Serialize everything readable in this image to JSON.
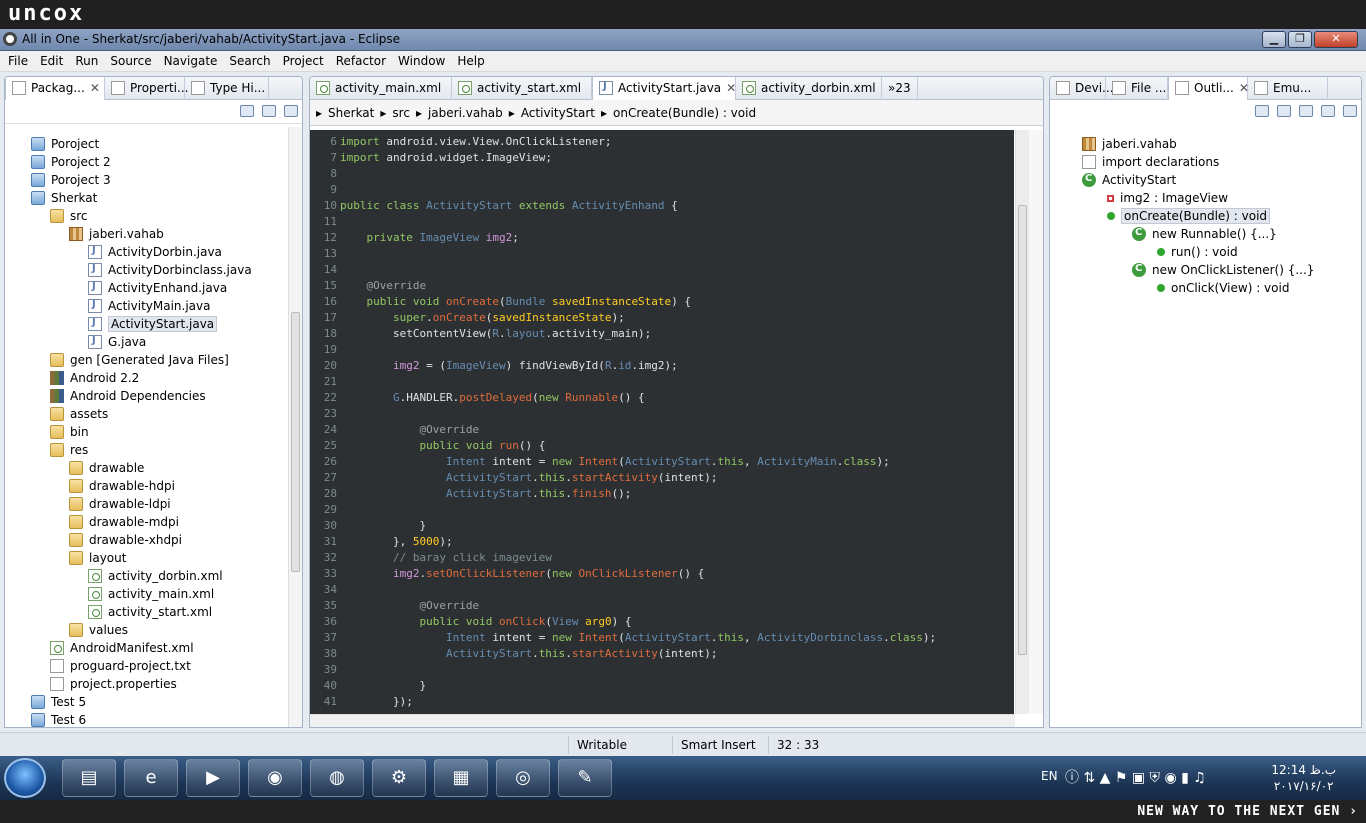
{
  "brand": {
    "top": "uncox",
    "bottom": "NEW WAY TO THE NEXT GEN ›"
  },
  "window": {
    "title": "All in One - Sherkat/src/jaberi/vahab/ActivityStart.java - Eclipse",
    "min": "▁",
    "max": "❐",
    "close": "✕"
  },
  "menu": [
    "File",
    "Edit",
    "Run",
    "Source",
    "Navigate",
    "Search",
    "Project",
    "Refactor",
    "Window",
    "Help"
  ],
  "left_tabs": [
    "Packag...",
    "Properti...",
    "Type Hi..."
  ],
  "tree": [
    {
      "label": "Poroject",
      "icon": "i-proj",
      "indent": 0
    },
    {
      "label": "Poroject 2",
      "icon": "i-proj",
      "indent": 0
    },
    {
      "label": "Poroject 3",
      "icon": "i-proj",
      "indent": 0
    },
    {
      "label": "Sherkat",
      "icon": "i-proj",
      "indent": 0
    },
    {
      "label": "src",
      "icon": "i-folder",
      "indent": 1
    },
    {
      "label": "jaberi.vahab",
      "icon": "i-pkg",
      "indent": 2
    },
    {
      "label": "ActivityDorbin.java",
      "icon": "i-java",
      "indent": 3
    },
    {
      "label": "ActivityDorbinclass.java",
      "icon": "i-java",
      "indent": 3
    },
    {
      "label": "ActivityEnhand.java",
      "icon": "i-java",
      "indent": 3
    },
    {
      "label": "ActivityMain.java",
      "icon": "i-java",
      "indent": 3
    },
    {
      "label": "ActivityStart.java",
      "icon": "i-java",
      "indent": 3,
      "selected": true
    },
    {
      "label": "G.java",
      "icon": "i-java",
      "indent": 3
    },
    {
      "label": "gen [Generated Java Files]",
      "icon": "i-folder",
      "indent": 1
    },
    {
      "label": "Android 2.2",
      "icon": "i-lib",
      "indent": 1
    },
    {
      "label": "Android Dependencies",
      "icon": "i-lib",
      "indent": 1
    },
    {
      "label": "assets",
      "icon": "i-folder",
      "indent": 1
    },
    {
      "label": "bin",
      "icon": "i-folder",
      "indent": 1
    },
    {
      "label": "res",
      "icon": "i-folder",
      "indent": 1
    },
    {
      "label": "drawable",
      "icon": "i-folder",
      "indent": 2
    },
    {
      "label": "drawable-hdpi",
      "icon": "i-folder",
      "indent": 2
    },
    {
      "label": "drawable-ldpi",
      "icon": "i-folder",
      "indent": 2
    },
    {
      "label": "drawable-mdpi",
      "icon": "i-folder",
      "indent": 2
    },
    {
      "label": "drawable-xhdpi",
      "icon": "i-folder",
      "indent": 2
    },
    {
      "label": "layout",
      "icon": "i-folder",
      "indent": 2
    },
    {
      "label": "activity_dorbin.xml",
      "icon": "i-xml",
      "indent": 3
    },
    {
      "label": "activity_main.xml",
      "icon": "i-xml",
      "indent": 3
    },
    {
      "label": "activity_start.xml",
      "icon": "i-xml",
      "indent": 3
    },
    {
      "label": "values",
      "icon": "i-folder",
      "indent": 2
    },
    {
      "label": "AndroidManifest.xml",
      "icon": "i-xml",
      "indent": 1
    },
    {
      "label": "proguard-project.txt",
      "icon": "i-file",
      "indent": 1
    },
    {
      "label": "project.properties",
      "icon": "i-file",
      "indent": 1
    },
    {
      "label": "Test 5",
      "icon": "i-proj",
      "indent": 0
    },
    {
      "label": "Test 6",
      "icon": "i-proj",
      "indent": 0
    }
  ],
  "editor_tabs": [
    {
      "label": "activity_main.xml",
      "icon": "i-xml"
    },
    {
      "label": "activity_start.xml",
      "icon": "i-xml"
    },
    {
      "label": "ActivityStart.java",
      "icon": "i-java",
      "active": true
    },
    {
      "label": "activity_dorbin.xml",
      "icon": "i-xml"
    }
  ],
  "editor_overflow": "»23",
  "breadcrumb": [
    "Sherkat",
    "src",
    "jaberi.vahab",
    "ActivityStart",
    "onCreate(Bundle) : void"
  ],
  "code": [
    {
      "n": "6",
      "h": "<span class='kw'>import</span> android.view.View.OnClickListener;"
    },
    {
      "n": "7",
      "h": "<span class='kw'>import</span> android.widget.ImageView;"
    },
    {
      "n": "8",
      "h": ""
    },
    {
      "n": "9",
      "h": ""
    },
    {
      "n": "10",
      "h": "<span class='kw'>public class</span> <span class='ty'>ActivityStart</span> <span class='kw'>extends</span> <span class='ty'>ActivityEnhand</span> {"
    },
    {
      "n": "11",
      "h": ""
    },
    {
      "n": "12",
      "h": "    <span class='kw'>private</span> <span class='ty'>ImageView</span> <span class='fd'>img2</span>;"
    },
    {
      "n": "13",
      "h": ""
    },
    {
      "n": "14",
      "h": ""
    },
    {
      "n": "15",
      "h": "    <span class='an'>@Override</span>"
    },
    {
      "n": "16",
      "h": "    <span class='kw'>public void</span> <span class='fn'>onCreate</span>(<span class='ty'>Bundle</span> <span class='num'>savedInstanceState</span>) {"
    },
    {
      "n": "17",
      "h": "        <span class='kw'>super</span>.<span class='fn'>onCreate</span>(<span class='num'>savedInstanceState</span>);"
    },
    {
      "n": "18",
      "h": "        setContentView(<span class='ty'>R</span>.<span class='ty'>layout</span>.activity_main);"
    },
    {
      "n": "19",
      "h": ""
    },
    {
      "n": "20",
      "h": "        <span class='fd'>img2</span> = (<span class='ty'>ImageView</span>) findViewById(<span class='ty'>R</span>.<span class='ty'>id</span>.img2);"
    },
    {
      "n": "21",
      "h": ""
    },
    {
      "n": "22",
      "h": "        <span class='ty'>G</span>.HANDLER.<span class='fn'>postDelayed</span>(<span class='kw'>new</span> <span class='fn'>Runnable</span>() {"
    },
    {
      "n": "23",
      "h": ""
    },
    {
      "n": "24",
      "h": "            <span class='an'>@Override</span>"
    },
    {
      "n": "25",
      "h": "            <span class='kw'>public void</span> <span class='fn'>run</span>() {"
    },
    {
      "n": "26",
      "h": "                <span class='ty'>Intent</span> intent = <span class='kw'>new</span> <span class='fn'>Intent</span>(<span class='ty'>ActivityStart</span>.<span class='kw'>this</span>, <span class='ty'>ActivityMain</span>.<span class='kw'>class</span>);"
    },
    {
      "n": "27",
      "h": "                <span class='ty'>ActivityStart</span>.<span class='kw'>this</span>.<span class='fn'>startActivity</span>(intent);"
    },
    {
      "n": "28",
      "h": "                <span class='ty'>ActivityStart</span>.<span class='kw'>this</span>.<span class='fn'>finish</span>();"
    },
    {
      "n": "29",
      "h": ""
    },
    {
      "n": "30",
      "h": "            }"
    },
    {
      "n": "31",
      "h": "        }, <span class='num'>5000</span>);"
    },
    {
      "n": "32",
      "h": "        <span class='cm'>// baray click imageview</span>"
    },
    {
      "n": "33",
      "h": "        <span class='fd'>img2</span>.<span class='fn'>setOnClickListener</span>(<span class='kw'>new</span> <span class='fn'>OnClickListener</span>() {"
    },
    {
      "n": "34",
      "h": ""
    },
    {
      "n": "35",
      "h": "            <span class='an'>@Override</span>"
    },
    {
      "n": "36",
      "h": "            <span class='kw'>public void</span> <span class='fn'>onClick</span>(<span class='ty'>View</span> <span class='num'>arg0</span>) {"
    },
    {
      "n": "37",
      "h": "                <span class='ty'>Intent</span> intent = <span class='kw'>new</span> <span class='fn'>Intent</span>(<span class='ty'>ActivityStart</span>.<span class='kw'>this</span>, <span class='ty'>ActivityDorbinclass</span>.<span class='kw'>class</span>);"
    },
    {
      "n": "38",
      "h": "                <span class='ty'>ActivityStart</span>.<span class='kw'>this</span>.<span class='fn'>startActivity</span>(intent);"
    },
    {
      "n": "39",
      "h": ""
    },
    {
      "n": "40",
      "h": "            }"
    },
    {
      "n": "41",
      "h": "        });"
    }
  ],
  "right_tabs": [
    "Devi...",
    "File ...",
    "Outli...",
    "Emu..."
  ],
  "outline": [
    {
      "label": "jaberi.vahab",
      "icon": "i-pkg",
      "indent": 0
    },
    {
      "label": "import declarations",
      "icon": "i-file",
      "indent": 0
    },
    {
      "label": "ActivityStart",
      "icon": "i-class",
      "indent": 0
    },
    {
      "label": "img2 : ImageView",
      "icon": "i-field",
      "indent": 1
    },
    {
      "label": "onCreate(Bundle) : void",
      "icon": "i-method",
      "indent": 1,
      "selected": true
    },
    {
      "label": "new Runnable() {...}",
      "icon": "i-class",
      "indent": 2
    },
    {
      "label": "run() : void",
      "icon": "i-method",
      "indent": 3
    },
    {
      "label": "new OnClickListener() {...}",
      "icon": "i-class",
      "indent": 2
    },
    {
      "label": "onClick(View) : void",
      "icon": "i-method",
      "indent": 3
    }
  ],
  "status": {
    "writable": "Writable",
    "insert": "Smart Insert",
    "position": "32 : 33"
  },
  "taskbar": {
    "lang": "EN",
    "time": "12:14 ب.ظ",
    "date": "۲۰۱۷/۱۶/۰۲"
  }
}
